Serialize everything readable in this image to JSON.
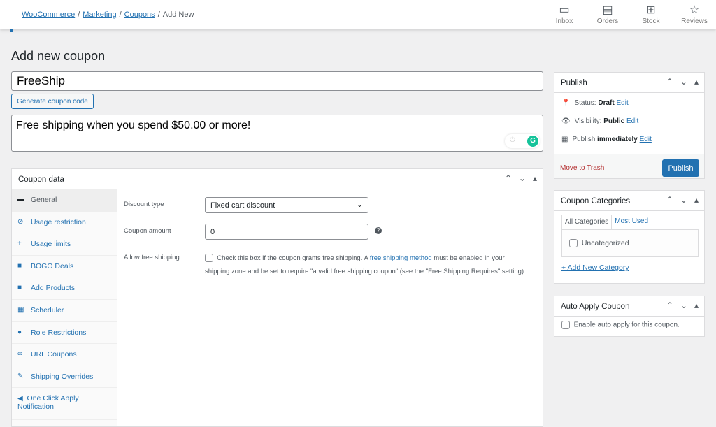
{
  "breadcrumb": {
    "items": [
      "WooCommerce",
      "Marketing",
      "Coupons"
    ],
    "current": "Add New",
    "separator": "/"
  },
  "toolbar": [
    {
      "label": "Inbox",
      "icon": "inbox-icon"
    },
    {
      "label": "Orders",
      "icon": "orders-icon"
    },
    {
      "label": "Stock",
      "icon": "stock-icon"
    },
    {
      "label": "Reviews",
      "icon": "star-icon"
    }
  ],
  "page_title": "Add new coupon",
  "coupon_code": "FreeShip",
  "generate_label": "Generate coupon code",
  "description": "Free shipping when you spend $50.00 or more!",
  "coupon_data": {
    "title": "Coupon data",
    "tabs": [
      {
        "label": "General",
        "active": true
      },
      {
        "label": "Usage restriction"
      },
      {
        "label": "Usage limits"
      },
      {
        "label": "BOGO Deals"
      },
      {
        "label": "Add Products"
      },
      {
        "label": "Scheduler"
      },
      {
        "label": "Role Restrictions"
      },
      {
        "label": "URL Coupons"
      },
      {
        "label": "Shipping Overrides"
      },
      {
        "label": "One Click Apply Notification"
      }
    ],
    "discount_type_label": "Discount type",
    "discount_type_value": "Fixed cart discount",
    "amount_label": "Coupon amount",
    "amount_value": "0",
    "free_shipping_label": "Allow free shipping",
    "free_shipping_text_1": "Check this box if the coupon grants free shipping. A",
    "free_shipping_link": "free shipping method",
    "free_shipping_text_2": "must be enabled in your shipping zone and be set to require \"a valid free shipping coupon\" (see the \"Free Shipping Requires\" setting)."
  },
  "publish": {
    "title": "Publish",
    "status_label": "Status:",
    "status_value": "Draft",
    "visibility_label": "Visibility:",
    "visibility_value": "Public",
    "publish_label": "Publish",
    "publish_value": "immediately",
    "edit": "Edit",
    "trash": "Move to Trash",
    "button": "Publish"
  },
  "categories": {
    "title": "Coupon Categories",
    "tab_all": "All Categories",
    "tab_most": "Most Used",
    "items": [
      "Uncategorized"
    ],
    "add": "+ Add New Category"
  },
  "auto_apply": {
    "title": "Auto Apply Coupon",
    "label": "Enable auto apply for this coupon."
  },
  "colors": {
    "accent": "#2271b1",
    "danger": "#b32d2e",
    "background": "#f0f0f1"
  }
}
